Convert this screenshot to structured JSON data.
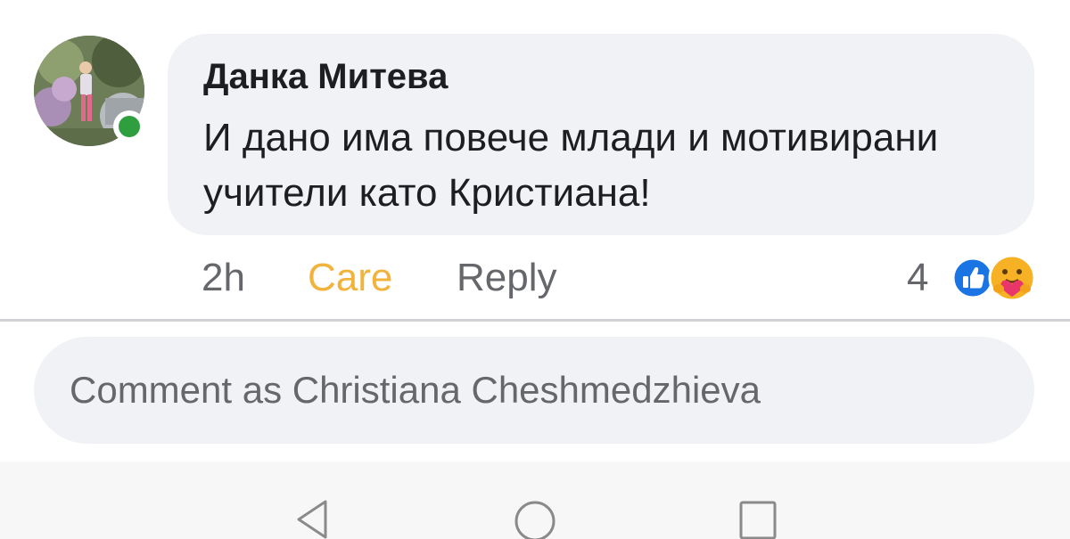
{
  "comment": {
    "author": "Данка Митева",
    "text": "И дано има повече млади и мотивирани учители като Кристиана!",
    "avatar_icon": "profile-photo",
    "online_status_color": "#2e9e3f"
  },
  "actions": {
    "time": "2h",
    "reaction_label": "Care",
    "reaction_color": "#f2b33d",
    "reply_label": "Reply"
  },
  "reactions": {
    "count": "4",
    "icons": [
      "like-icon",
      "care-icon"
    ]
  },
  "comment_input": {
    "placeholder": "Comment as Christiana Cheshmedzhieva"
  },
  "navbar": {
    "icons": [
      "back-icon",
      "home-icon",
      "recents-icon"
    ]
  }
}
